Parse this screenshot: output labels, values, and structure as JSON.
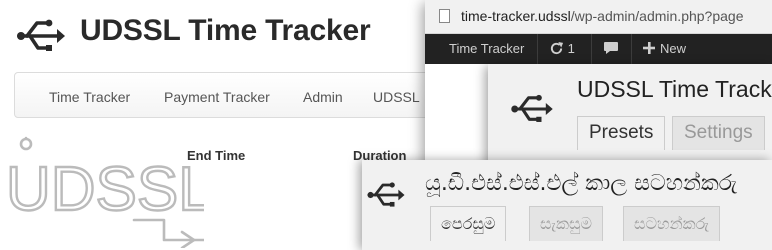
{
  "site": {
    "title": "UDSSL Time Tracker",
    "nav": [
      "Time Tracker",
      "Payment Tracker",
      "Admin",
      "UDSSL"
    ],
    "table_headers": {
      "end_time": "End Time",
      "duration": "Duration"
    },
    "watermark_text": "UDSSL"
  },
  "browser": {
    "url_host": "time-tracker.udssl",
    "url_path": "/wp-admin/admin.php?page",
    "adminbar": {
      "site_label": "Time Tracker",
      "updates_count": "1",
      "new_label": "New"
    }
  },
  "plugin_panel": {
    "title": "UDSSL Time Track",
    "tabs": [
      {
        "label": "Presets",
        "active": true
      },
      {
        "label": "Settings",
        "active": false
      }
    ]
  },
  "sinhala_panel": {
    "title": "යූ.ඩී.එස්.එස්.එල් කාල සටහන්කරු",
    "tabs": [
      {
        "label": "පෙරසුම",
        "active": true
      },
      {
        "label": "සැකසුම",
        "active": false
      },
      {
        "label": "සටහන්කරු",
        "active": false
      }
    ]
  },
  "icons": {
    "logo": "usb-icon",
    "url_page": "document-icon",
    "updates": "refresh-icon",
    "comments": "comment-icon",
    "new": "plus-icon"
  },
  "colors": {
    "adminbar": "#222222",
    "panel_bg": "#f1f1f1",
    "title": "#2a2a2a"
  }
}
